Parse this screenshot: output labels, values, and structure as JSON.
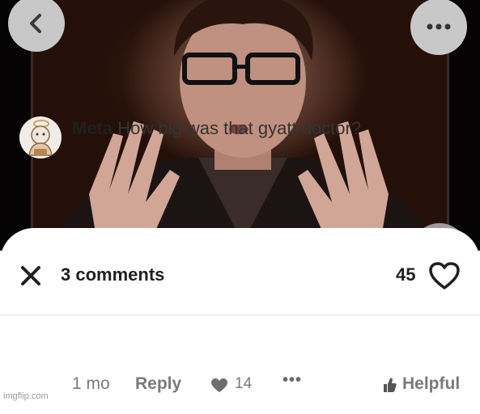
{
  "header": {
    "comments_label": "3 comments",
    "likes_count": "45"
  },
  "comment": {
    "author": "Meta",
    "text": "How big was that gyatt doctor?",
    "time_ago": "1 mo",
    "reply_label": "Reply",
    "like_count": "14",
    "more_label": "•••",
    "helpful_label": "Helpful"
  },
  "icons": {
    "back": "chevron-left-icon",
    "more": "more-horizontal-icon",
    "close": "close-icon",
    "heart": "heart-outline-icon",
    "like": "heart-filled-icon",
    "helpful": "thumbs-up-icon"
  },
  "colors": {
    "overlay_button": "#c8c8c8",
    "text_primary": "#1f1f1f",
    "text_secondary": "#7a7a7a"
  },
  "watermark": "imgflip.com"
}
